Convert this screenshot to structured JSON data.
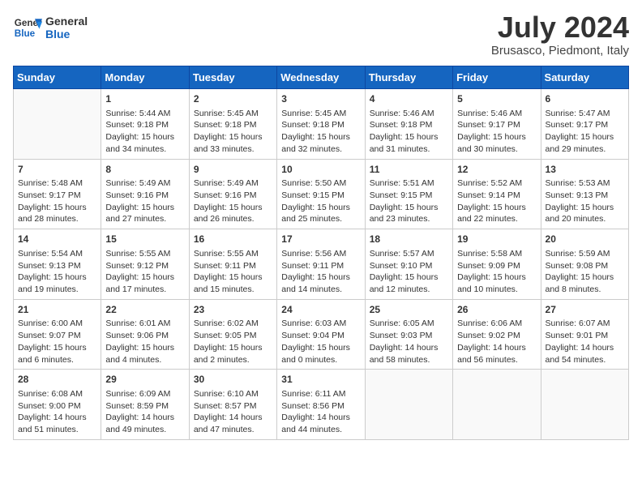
{
  "header": {
    "logo_line1": "General",
    "logo_line2": "Blue",
    "month": "July 2024",
    "location": "Brusasco, Piedmont, Italy"
  },
  "weekdays": [
    "Sunday",
    "Monday",
    "Tuesday",
    "Wednesday",
    "Thursday",
    "Friday",
    "Saturday"
  ],
  "weeks": [
    [
      {
        "day": null
      },
      {
        "day": "1",
        "sunrise": "5:44 AM",
        "sunset": "9:18 PM",
        "daylight": "15 hours and 34 minutes."
      },
      {
        "day": "2",
        "sunrise": "5:45 AM",
        "sunset": "9:18 PM",
        "daylight": "15 hours and 33 minutes."
      },
      {
        "day": "3",
        "sunrise": "5:45 AM",
        "sunset": "9:18 PM",
        "daylight": "15 hours and 32 minutes."
      },
      {
        "day": "4",
        "sunrise": "5:46 AM",
        "sunset": "9:18 PM",
        "daylight": "15 hours and 31 minutes."
      },
      {
        "day": "5",
        "sunrise": "5:46 AM",
        "sunset": "9:17 PM",
        "daylight": "15 hours and 30 minutes."
      },
      {
        "day": "6",
        "sunrise": "5:47 AM",
        "sunset": "9:17 PM",
        "daylight": "15 hours and 29 minutes."
      }
    ],
    [
      {
        "day": "7",
        "sunrise": "5:48 AM",
        "sunset": "9:17 PM",
        "daylight": "15 hours and 28 minutes."
      },
      {
        "day": "8",
        "sunrise": "5:49 AM",
        "sunset": "9:16 PM",
        "daylight": "15 hours and 27 minutes."
      },
      {
        "day": "9",
        "sunrise": "5:49 AM",
        "sunset": "9:16 PM",
        "daylight": "15 hours and 26 minutes."
      },
      {
        "day": "10",
        "sunrise": "5:50 AM",
        "sunset": "9:15 PM",
        "daylight": "15 hours and 25 minutes."
      },
      {
        "day": "11",
        "sunrise": "5:51 AM",
        "sunset": "9:15 PM",
        "daylight": "15 hours and 23 minutes."
      },
      {
        "day": "12",
        "sunrise": "5:52 AM",
        "sunset": "9:14 PM",
        "daylight": "15 hours and 22 minutes."
      },
      {
        "day": "13",
        "sunrise": "5:53 AM",
        "sunset": "9:13 PM",
        "daylight": "15 hours and 20 minutes."
      }
    ],
    [
      {
        "day": "14",
        "sunrise": "5:54 AM",
        "sunset": "9:13 PM",
        "daylight": "15 hours and 19 minutes."
      },
      {
        "day": "15",
        "sunrise": "5:55 AM",
        "sunset": "9:12 PM",
        "daylight": "15 hours and 17 minutes."
      },
      {
        "day": "16",
        "sunrise": "5:55 AM",
        "sunset": "9:11 PM",
        "daylight": "15 hours and 15 minutes."
      },
      {
        "day": "17",
        "sunrise": "5:56 AM",
        "sunset": "9:11 PM",
        "daylight": "15 hours and 14 minutes."
      },
      {
        "day": "18",
        "sunrise": "5:57 AM",
        "sunset": "9:10 PM",
        "daylight": "15 hours and 12 minutes."
      },
      {
        "day": "19",
        "sunrise": "5:58 AM",
        "sunset": "9:09 PM",
        "daylight": "15 hours and 10 minutes."
      },
      {
        "day": "20",
        "sunrise": "5:59 AM",
        "sunset": "9:08 PM",
        "daylight": "15 hours and 8 minutes."
      }
    ],
    [
      {
        "day": "21",
        "sunrise": "6:00 AM",
        "sunset": "9:07 PM",
        "daylight": "15 hours and 6 minutes."
      },
      {
        "day": "22",
        "sunrise": "6:01 AM",
        "sunset": "9:06 PM",
        "daylight": "15 hours and 4 minutes."
      },
      {
        "day": "23",
        "sunrise": "6:02 AM",
        "sunset": "9:05 PM",
        "daylight": "15 hours and 2 minutes."
      },
      {
        "day": "24",
        "sunrise": "6:03 AM",
        "sunset": "9:04 PM",
        "daylight": "15 hours and 0 minutes."
      },
      {
        "day": "25",
        "sunrise": "6:05 AM",
        "sunset": "9:03 PM",
        "daylight": "14 hours and 58 minutes."
      },
      {
        "day": "26",
        "sunrise": "6:06 AM",
        "sunset": "9:02 PM",
        "daylight": "14 hours and 56 minutes."
      },
      {
        "day": "27",
        "sunrise": "6:07 AM",
        "sunset": "9:01 PM",
        "daylight": "14 hours and 54 minutes."
      }
    ],
    [
      {
        "day": "28",
        "sunrise": "6:08 AM",
        "sunset": "9:00 PM",
        "daylight": "14 hours and 51 minutes."
      },
      {
        "day": "29",
        "sunrise": "6:09 AM",
        "sunset": "8:59 PM",
        "daylight": "14 hours and 49 minutes."
      },
      {
        "day": "30",
        "sunrise": "6:10 AM",
        "sunset": "8:57 PM",
        "daylight": "14 hours and 47 minutes."
      },
      {
        "day": "31",
        "sunrise": "6:11 AM",
        "sunset": "8:56 PM",
        "daylight": "14 hours and 44 minutes."
      },
      {
        "day": null
      },
      {
        "day": null
      },
      {
        "day": null
      }
    ]
  ]
}
